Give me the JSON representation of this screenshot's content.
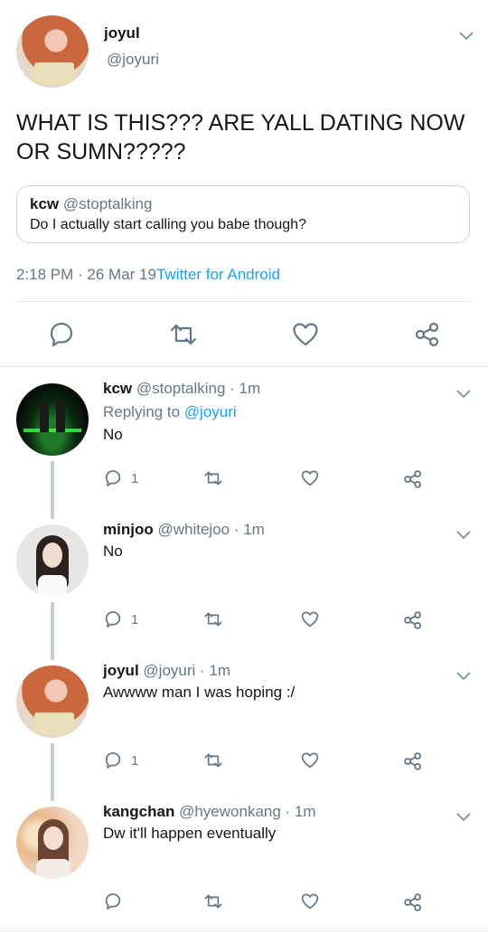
{
  "main_tweet": {
    "name": "joyul",
    "handle": "@joyuri",
    "text": "WHAT IS THIS??? ARE YALL DATING NOW OR SUMN?????",
    "quoted": {
      "name": "kcw",
      "handle": "@stoptalking",
      "text": "Do I actually start calling you babe though?"
    },
    "timestamp": "2:18 PM · 26 Mar 19",
    "source": "Twitter for Android"
  },
  "replies": [
    {
      "name": "kcw",
      "handle": "@stoptalking",
      "time": "· 1m",
      "replying_label": "Replying to",
      "replying_to": "@joyuri",
      "text": "No",
      "reply_count": "1"
    },
    {
      "name": "minjoo",
      "handle": "@whitejoo",
      "time": "· 1m",
      "text": "No",
      "reply_count": "1"
    },
    {
      "name": "joyul",
      "handle": "@joyuri",
      "time": "· 1m",
      "text": "Awwww man I was hoping :/",
      "reply_count": "1"
    },
    {
      "name": "kangchan",
      "handle": "@hyewonkang",
      "time": "· 1m",
      "text": "Dw it'll happen eventually",
      "reply_count": ""
    }
  ],
  "colors": {
    "link": "#1da1f2",
    "secondary": "#657786",
    "icon": "#657786",
    "thread_line": "#c4ced6",
    "divider": "#e1e8ed"
  },
  "icons": [
    "chevron-down-icon",
    "reply-icon",
    "retweet-icon",
    "like-icon",
    "share-icon"
  ]
}
